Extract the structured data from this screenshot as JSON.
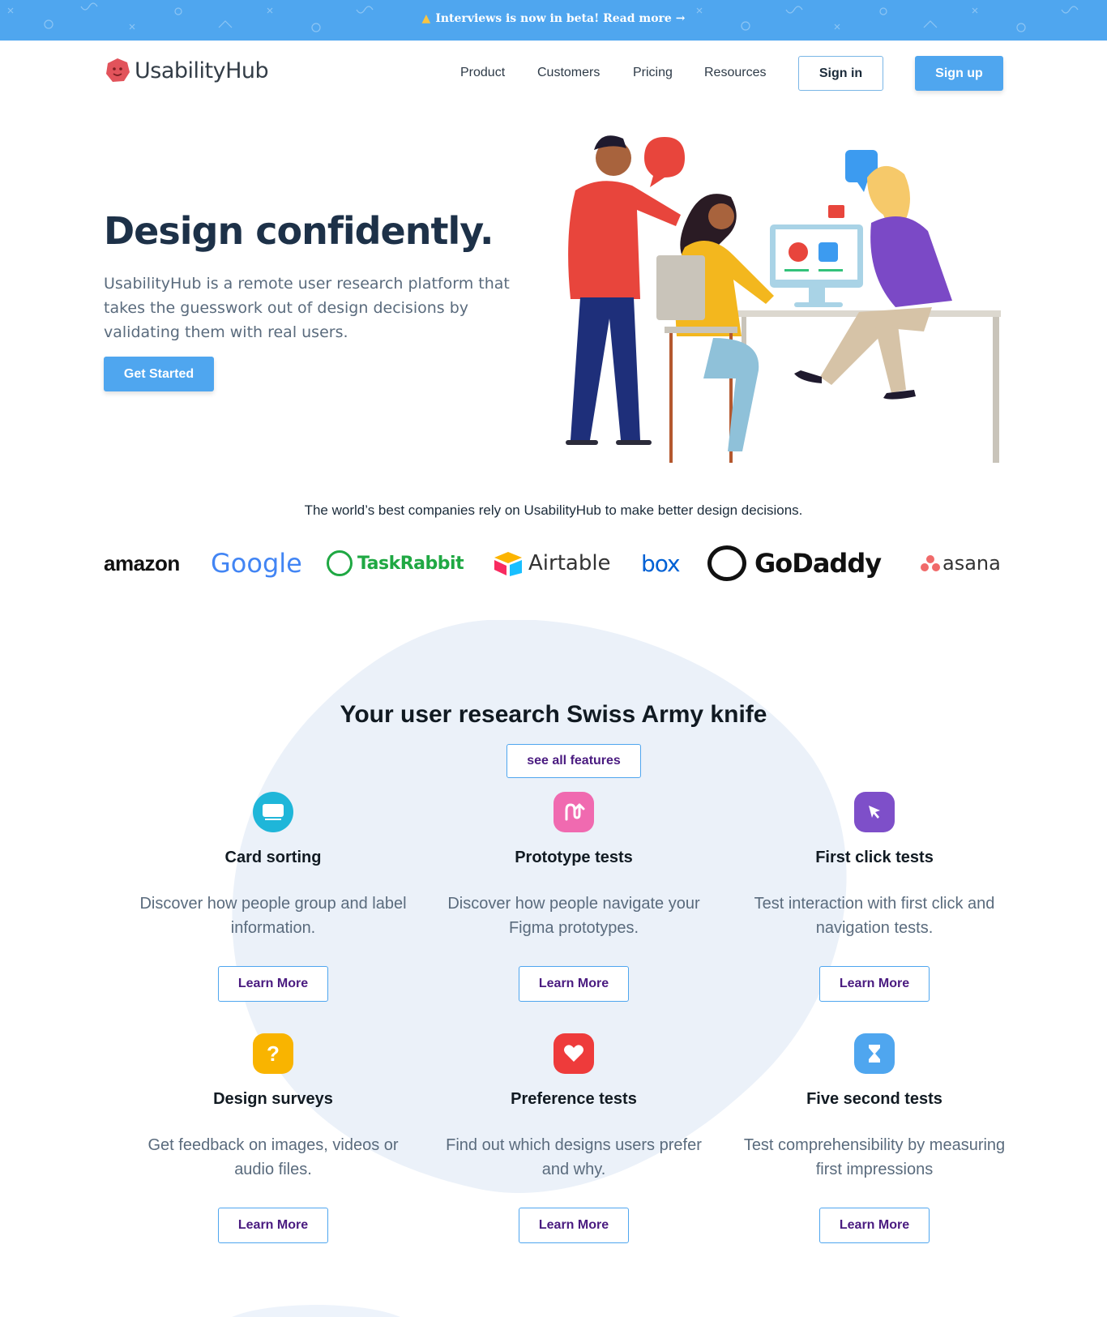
{
  "banner": {
    "text": "Interviews is now in beta! Read more →",
    "icon": "megaphone-icon",
    "color": "#4fa6ef"
  },
  "nav": {
    "logo_text": "UsabilityHub",
    "links": [
      "Product",
      "Customers",
      "Pricing",
      "Resources"
    ],
    "signin_label": "Sign in",
    "signup_label": "Sign up"
  },
  "hero": {
    "title": "Design confidently.",
    "description": "UsabilityHub is a remote user research platform that takes the guesswork out of design decisions by validating them with real users.",
    "cta_label": "Get Started"
  },
  "trust": {
    "text": "The world’s best companies rely on UsabilityHub to make better design decisions.",
    "brands": [
      "amazon",
      "Google",
      "TaskRabbit",
      "Airtable",
      "box",
      "GoDaddy",
      "asana"
    ]
  },
  "features": {
    "title": "Your user research Swiss Army knife",
    "see_all_label": "see all features",
    "cards": [
      {
        "title": "Card sorting",
        "description": "Discover how people group and label information.",
        "button": "Learn More",
        "icon": "card-stack-icon",
        "color": "#1fb6d9"
      },
      {
        "title": "Prototype tests",
        "description": "Discover how people navigate your Figma prototypes.",
        "button": "Learn More",
        "icon": "flow-arrow-icon",
        "color": "#f06ab0"
      },
      {
        "title": "First click tests",
        "description": "Test interaction with first click and navigation tests.",
        "button": "Learn More",
        "icon": "cursor-icon",
        "color": "#7e4fc9"
      },
      {
        "title": "Design surveys",
        "description": "Get feedback on images, videos or audio files.",
        "button": "Learn More",
        "icon": "question-icon",
        "color": "#f9b400"
      },
      {
        "title": "Preference tests",
        "description": "Find out which designs users prefer and why.",
        "button": "Learn More",
        "icon": "heart-icon",
        "color": "#ee3b3b"
      },
      {
        "title": "Five second tests",
        "description": "Test comprehensibility by measuring first impressions",
        "button": "Learn More",
        "icon": "hourglass-icon",
        "color": "#4fa6ef"
      }
    ]
  }
}
